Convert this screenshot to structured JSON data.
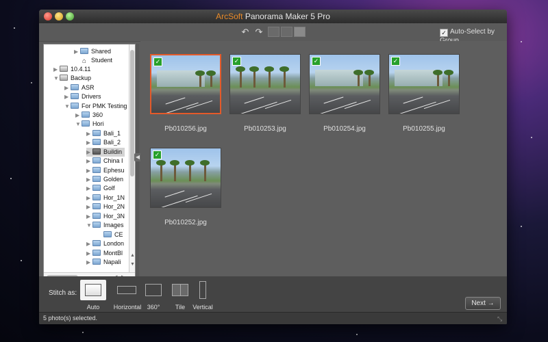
{
  "app": {
    "title_brand": "ArcSoft",
    "title_rest": " Panorama Maker 5 Pro",
    "accent": "#e45a2a"
  },
  "toolbar": {
    "rotate_left_icon": "rotate-left-icon",
    "rotate_right_icon": "rotate-right-icon",
    "auto_select_label": "Auto-Select by Group",
    "auto_select_checked": true
  },
  "tree": {
    "items": [
      {
        "label": "Shared",
        "icon": "folder-icon"
      },
      {
        "label": "Student",
        "icon": "home-icon"
      },
      {
        "label": "10.4.11",
        "icon": "drive-icon"
      },
      {
        "label": "Backup",
        "icon": "drive-icon"
      },
      {
        "label": "ASR",
        "icon": "folder-icon"
      },
      {
        "label": "Drivers",
        "icon": "folder-icon"
      },
      {
        "label": "For PMK Testing",
        "icon": "folder-icon"
      },
      {
        "label": "360",
        "icon": "folder-icon"
      },
      {
        "label": "Hori",
        "icon": "folder-icon"
      },
      {
        "label": "Bali_1",
        "icon": "folder-icon"
      },
      {
        "label": "Bali_2",
        "icon": "folder-icon"
      },
      {
        "label": "Buildin",
        "icon": "folder-icon",
        "selected": true
      },
      {
        "label": "China I",
        "icon": "folder-icon"
      },
      {
        "label": "Ephesu",
        "icon": "folder-icon"
      },
      {
        "label": "Golden",
        "icon": "folder-icon"
      },
      {
        "label": "Golf",
        "icon": "folder-icon"
      },
      {
        "label": "Hor_1N",
        "icon": "folder-icon"
      },
      {
        "label": "Hor_2N",
        "icon": "folder-icon"
      },
      {
        "label": "Hor_3N",
        "icon": "folder-icon"
      },
      {
        "label": "Images",
        "icon": "folder-icon"
      },
      {
        "label": "CE",
        "icon": "folder-icon"
      },
      {
        "label": "London",
        "icon": "folder-icon"
      },
      {
        "label": "MontBl",
        "icon": "folder-icon"
      },
      {
        "label": "Napali",
        "icon": "folder-icon"
      }
    ]
  },
  "photos": [
    {
      "name": "Pb010256.jpg",
      "checked": true,
      "selected": true,
      "scene": "building"
    },
    {
      "name": "Pb010253.jpg",
      "checked": true,
      "selected": false,
      "scene": "palms"
    },
    {
      "name": "Pb010254.jpg",
      "checked": true,
      "selected": false,
      "scene": "building"
    },
    {
      "name": "Pb010255.jpg",
      "checked": true,
      "selected": false,
      "scene": "building"
    },
    {
      "name": "Pb010252.jpg",
      "checked": true,
      "selected": false,
      "scene": "palms"
    }
  ],
  "stitch": {
    "label": "Stitch as:",
    "modes": [
      {
        "label": "Auto",
        "active": true
      },
      {
        "label": "Horizontal",
        "active": false
      },
      {
        "label": "360°",
        "active": false
      },
      {
        "label": "Tile",
        "active": false
      },
      {
        "label": "Vertical",
        "active": false
      }
    ]
  },
  "next_label": "Next",
  "status": "5 photo(s) selected."
}
